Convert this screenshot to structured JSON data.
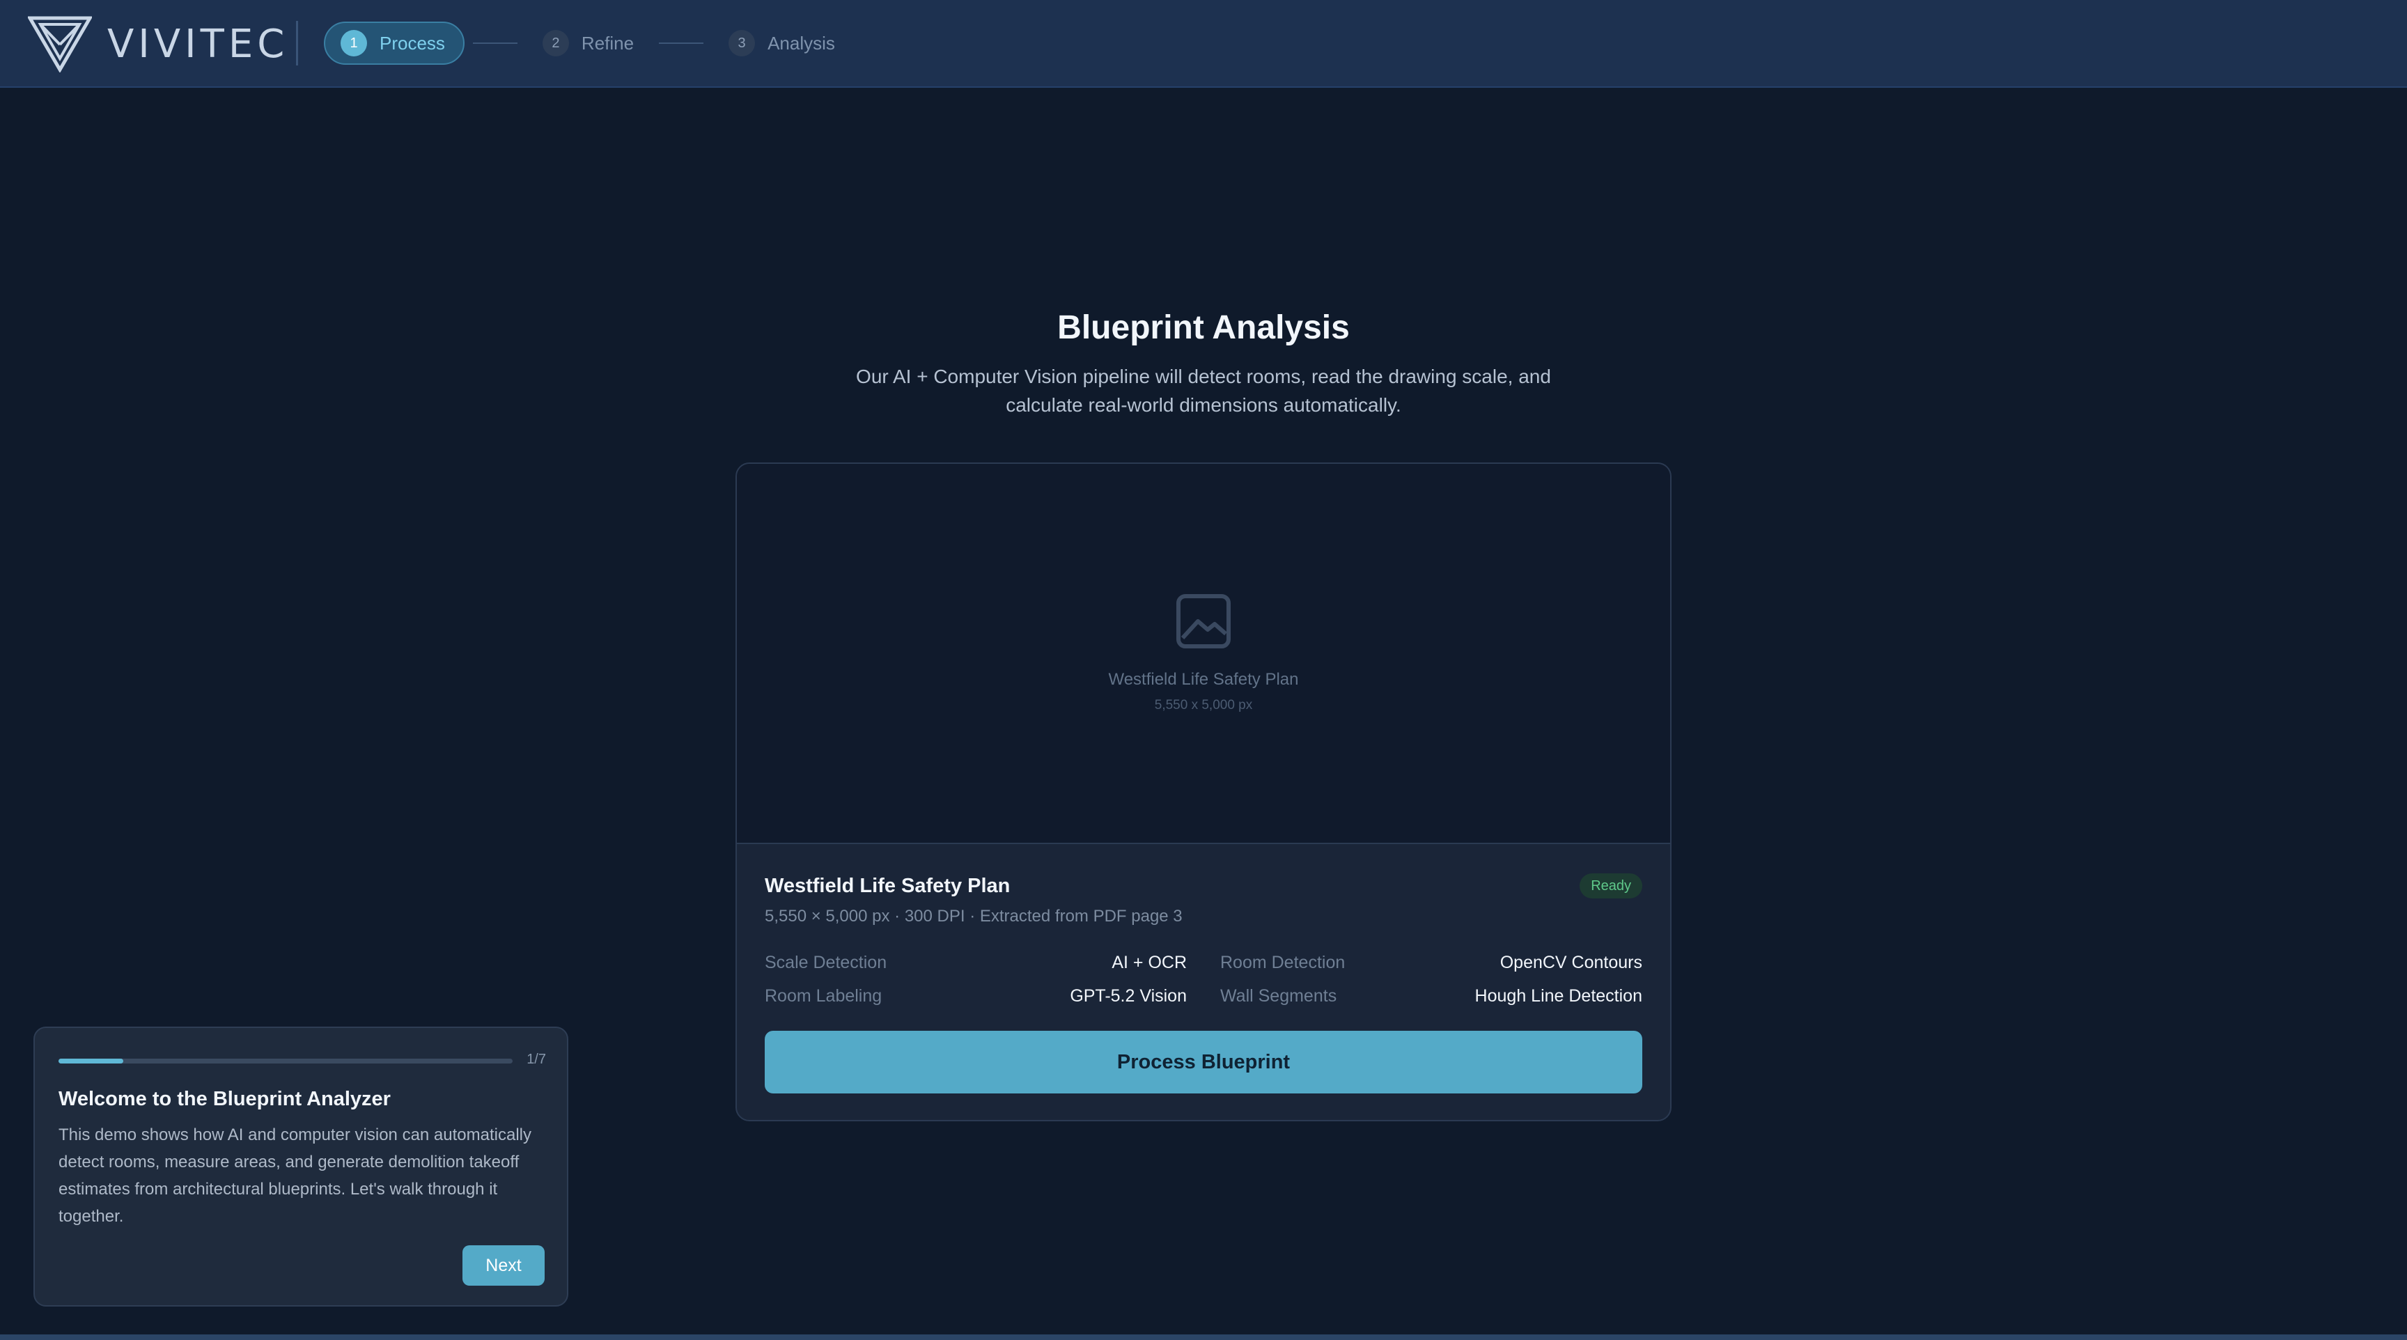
{
  "header": {
    "brand": "VIVITEC",
    "steps": [
      {
        "num": "1",
        "label": "Process"
      },
      {
        "num": "2",
        "label": "Refine"
      },
      {
        "num": "3",
        "label": "Analysis"
      }
    ]
  },
  "main": {
    "title": "Blueprint Analysis",
    "subtitle": "Our AI + Computer Vision pipeline will detect rooms, read the drawing scale, and calculate real-world dimensions automatically."
  },
  "card": {
    "preview_name": "Westfield Life Safety Plan",
    "preview_dims": "5,550 x 5,000 px",
    "file_title": "Westfield Life Safety Plan",
    "status": "Ready",
    "file_meta": "5,550 × 5,000 px · 300 DPI · Extracted from PDF page 3",
    "specs": [
      {
        "label": "Scale Detection",
        "value": "AI + OCR"
      },
      {
        "label": "Room Detection",
        "value": "OpenCV Contours"
      },
      {
        "label": "Room Labeling",
        "value": "GPT-5.2 Vision"
      },
      {
        "label": "Wall Segments",
        "value": "Hough Line Detection"
      }
    ],
    "button_label": "Process Blueprint"
  },
  "tour": {
    "counter": "1/7",
    "progress_fraction": 0.143,
    "title": "Welcome to the Blueprint Analyzer",
    "text": "This demo shows how AI and computer vision can automatically detect rooms, measure areas, and generate demolition takeoff estimates from architectural blueprints. Let's walk through it together.",
    "next_label": "Next"
  },
  "colors": {
    "accent": "#54aac8",
    "header_bg": "#1d3150",
    "page_bg": "#0f1a2b",
    "ready_green": "#5fc98a"
  },
  "icons": {
    "logo": "triangle-v-logo-icon",
    "preview": "image-placeholder-icon"
  }
}
